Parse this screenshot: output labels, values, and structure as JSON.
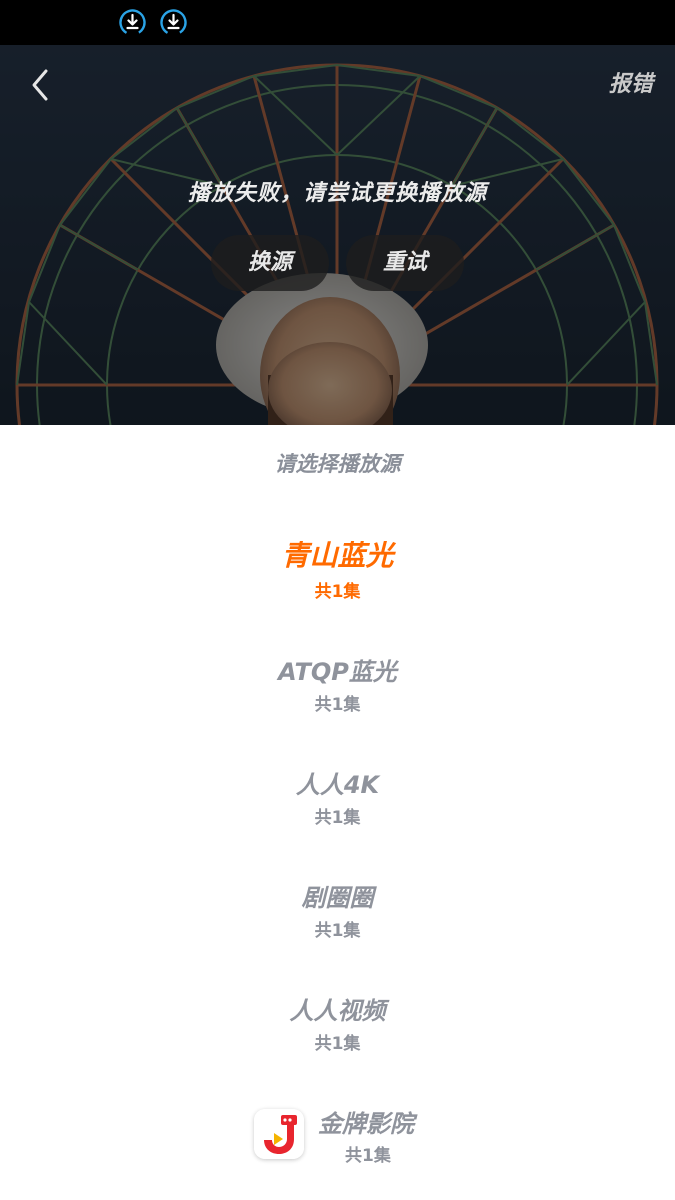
{
  "status_bar": {
    "icons": [
      "download-circle-icon",
      "download-circle-icon"
    ],
    "icon_color": "#2aa3e6"
  },
  "player": {
    "back_icon": "chevron-left-icon",
    "report_label": "报错",
    "error_message": "播放失败，请尝试更换播放源",
    "switch_source_label": "换源",
    "retry_label": "重试"
  },
  "source_list": {
    "title": "请选择播放源",
    "accent_color": "#ff6a00",
    "items": [
      {
        "name": "青山蓝光",
        "count": "共1集",
        "selected": true
      },
      {
        "name": "ATQP蓝光",
        "count": "共1集",
        "selected": false
      },
      {
        "name": "人人4K",
        "count": "共1集",
        "selected": false
      },
      {
        "name": "剧圈圈",
        "count": "共1集",
        "selected": false
      },
      {
        "name": "人人视频",
        "count": "共1集",
        "selected": false
      },
      {
        "name": "金牌影院",
        "count": "共1集",
        "selected": false,
        "icon": "jinpai-app-icon"
      }
    ]
  }
}
